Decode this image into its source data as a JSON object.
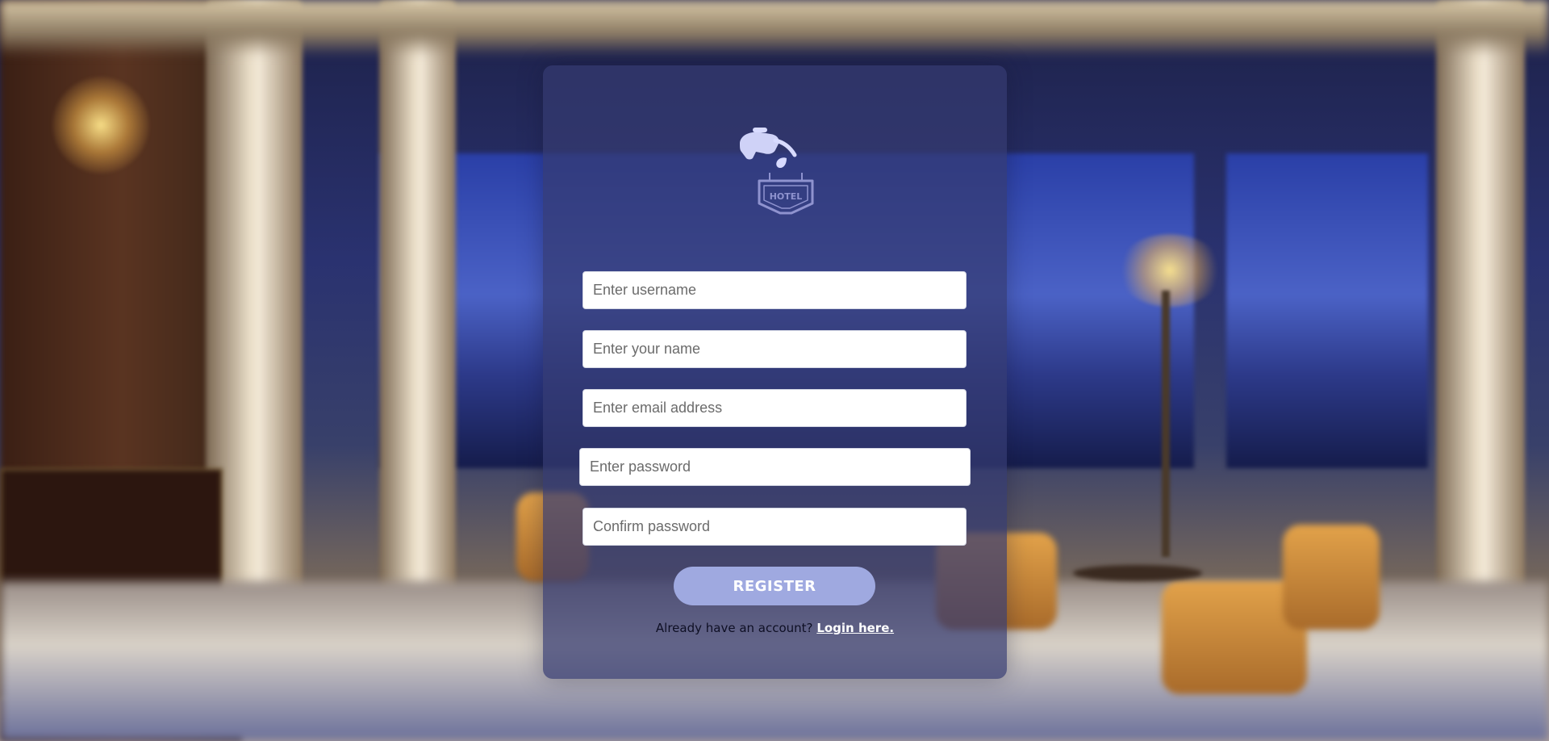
{
  "logo": {
    "icon": "hotel-sign-icon",
    "sign_text": "HOTEL",
    "color": "#cfd2ff"
  },
  "form": {
    "username_placeholder": "Enter username",
    "name_placeholder": "Enter your name",
    "email_placeholder": "Enter email address",
    "password_placeholder": "Enter password",
    "confirm_password_placeholder": "Confirm password",
    "register_label": "REGISTER",
    "login_prompt": "Already have an account?",
    "login_link": "Login here."
  },
  "colors": {
    "card_bg": "#343a70",
    "button_bg": "#9fa9e0",
    "button_text": "#ffffff"
  }
}
